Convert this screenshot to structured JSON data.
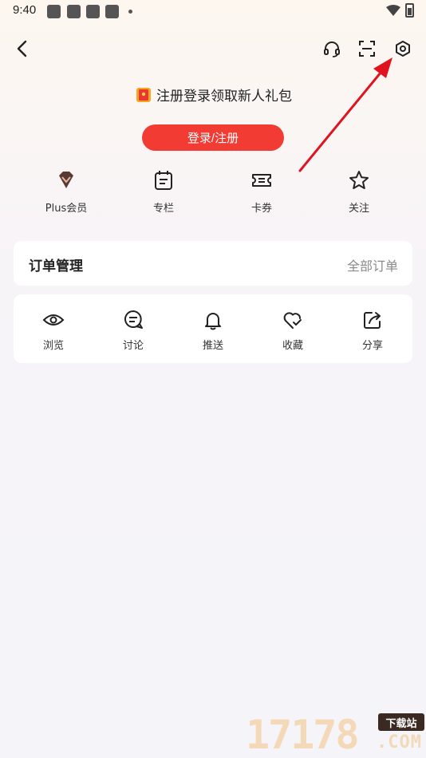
{
  "status_bar": {
    "time": "9:40"
  },
  "header": {
    "back_icon": "chevron-left-icon",
    "right_icons": [
      "headset-icon",
      "scan-icon",
      "settings-icon"
    ]
  },
  "promo": {
    "icon": "red-envelope-icon",
    "text": "注册登录领取新人礼包"
  },
  "login_button": {
    "label": "登录/注册",
    "color": "#f13b33"
  },
  "quick_links": [
    {
      "label": "Plus会员",
      "icon": "diamond-icon"
    },
    {
      "label": "专栏",
      "icon": "calendar-note-icon"
    },
    {
      "label": "卡券",
      "icon": "ticket-icon"
    },
    {
      "label": "关注",
      "icon": "star-icon"
    }
  ],
  "order": {
    "title": "订单管理",
    "all_label": "全部订单"
  },
  "tools": [
    {
      "label": "浏览",
      "icon": "eye-icon"
    },
    {
      "label": "讨论",
      "icon": "chat-icon"
    },
    {
      "label": "推送",
      "icon": "bell-icon"
    },
    {
      "label": "收藏",
      "icon": "heart-check-icon"
    },
    {
      "label": "分享",
      "icon": "share-icon"
    }
  ],
  "annotation": {
    "arrow_color": "#e0141e"
  },
  "watermark": {
    "digits": "17178",
    "badge": "下载站",
    "suffix": ".COM"
  }
}
